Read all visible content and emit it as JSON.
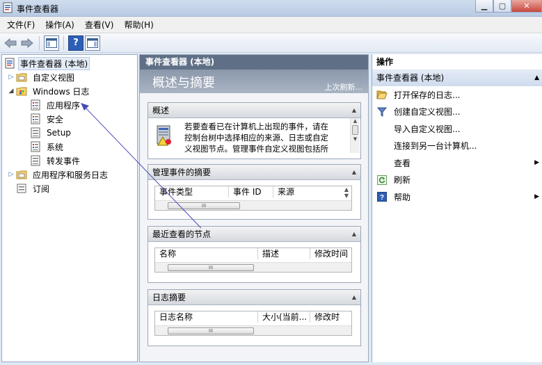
{
  "window": {
    "title": "事件查看器"
  },
  "menu": [
    "文件(F)",
    "操作(A)",
    "查看(V)",
    "帮助(H)"
  ],
  "tree": [
    {
      "label": "事件查看器 (本地)",
      "icon": "event-viewer-icon",
      "arrow": "",
      "indent": 0,
      "selected": true
    },
    {
      "label": "自定义视图",
      "icon": "folder-icon",
      "arrow": "▷",
      "indent": 1,
      "selected": false
    },
    {
      "label": "Windows 日志",
      "icon": "windows-log-folder-icon",
      "arrow": "◢",
      "indent": 1,
      "selected": false
    },
    {
      "label": "应用程序",
      "icon": "log-icon",
      "arrow": "",
      "indent": 2,
      "selected": false
    },
    {
      "label": "安全",
      "icon": "log-icon",
      "arrow": "",
      "indent": 2,
      "selected": false
    },
    {
      "label": "Setup",
      "icon": "log-icon",
      "arrow": "",
      "indent": 2,
      "selected": false
    },
    {
      "label": "系统",
      "icon": "log-icon",
      "arrow": "",
      "indent": 2,
      "selected": false
    },
    {
      "label": "转发事件",
      "icon": "log-icon",
      "arrow": "",
      "indent": 2,
      "selected": false
    },
    {
      "label": "应用程序和服务日志",
      "icon": "folder-icon",
      "arrow": "▷",
      "indent": 1,
      "selected": false
    },
    {
      "label": "订阅",
      "icon": "subscription-icon",
      "arrow": "",
      "indent": 1,
      "selected": false
    }
  ],
  "center": {
    "header": "事件查看器 (本地)",
    "overview_title": "概述与摘要",
    "last_refresh": "上次刷新...",
    "overview": {
      "title": "概述",
      "text": "若要查看已在计算机上出现的事件，请在控制台树中选择相应的来源、日志或自定义视图节点。管理事件自定义视图包括所"
    },
    "sections": [
      {
        "title": "管理事件的摘要",
        "columns": [
          "事件类型",
          "事件 ID",
          "来源"
        ]
      },
      {
        "title": "最近查看的节点",
        "columns": [
          "名称",
          "描述",
          "修改时间"
        ]
      },
      {
        "title": "日志摘要",
        "columns": [
          "日志名称",
          "大小(当前...",
          "修改时"
        ]
      }
    ]
  },
  "actions": {
    "title": "操作",
    "group": "事件查看器 (本地)",
    "items": [
      {
        "label": "打开保存的日志...",
        "icon": "open-folder-icon",
        "submenu": false
      },
      {
        "label": "创建自定义视图...",
        "icon": "filter-icon",
        "submenu": false
      },
      {
        "label": "导入自定义视图...",
        "icon": "",
        "submenu": false
      },
      {
        "label": "连接到另一台计算机...",
        "icon": "",
        "submenu": false
      },
      {
        "label": "查看",
        "icon": "",
        "submenu": true
      },
      {
        "label": "刷新",
        "icon": "refresh-icon",
        "submenu": false
      },
      {
        "label": "帮助",
        "icon": "help-icon",
        "submenu": true
      }
    ]
  },
  "colors": {
    "accent_header": "#5f6f86",
    "selection": "#e4ecf7",
    "pane_border": "#9aaabd"
  }
}
